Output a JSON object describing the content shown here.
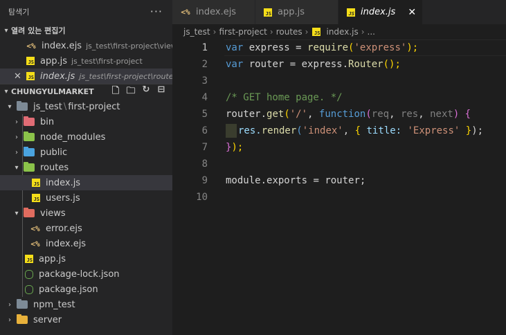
{
  "sidebar": {
    "title": "탐색기",
    "more": "···",
    "open_editors": {
      "header": "열려 있는 편집기",
      "items": [
        {
          "name": "index.ejs",
          "desc": "js_test\\first-project\\views"
        },
        {
          "name": "app.js",
          "desc": "js_test\\first-project"
        },
        {
          "name": "index.js",
          "desc": "js_test\\first-project\\routes"
        }
      ]
    },
    "workspace": {
      "header": "CHUNGYULMARKET",
      "tree": [
        {
          "label": "js_test",
          "label2": "first-project"
        },
        {
          "label": "bin"
        },
        {
          "label": "node_modules"
        },
        {
          "label": "public"
        },
        {
          "label": "routes"
        },
        {
          "label": "index.js"
        },
        {
          "label": "users.js"
        },
        {
          "label": "views"
        },
        {
          "label": "error.ejs"
        },
        {
          "label": "index.ejs"
        },
        {
          "label": "app.js"
        },
        {
          "label": "package-lock.json"
        },
        {
          "label": "package.json"
        },
        {
          "label": "npm_test"
        },
        {
          "label": "server"
        }
      ]
    }
  },
  "tabs": [
    {
      "label": "index.ejs",
      "icon": "ejs-file-icon"
    },
    {
      "label": "app.js",
      "icon": "js-file-icon"
    },
    {
      "label": "index.js",
      "icon": "js-file-icon",
      "active": true
    }
  ],
  "breadcrumb": [
    "js_test",
    "first-project",
    "routes",
    "index.js",
    "..."
  ],
  "code": {
    "line_numbers": [
      "1",
      "2",
      "3",
      "4",
      "5",
      "6",
      "7",
      "8",
      "9",
      "10"
    ],
    "l1": [
      "var",
      " express = ",
      "require",
      "(",
      "'express'",
      ");"
    ],
    "l2": [
      "var",
      " router = express.",
      "Router",
      "();"
    ],
    "l4": "/* GET home page. */",
    "l5": [
      "router.",
      "get",
      "(",
      "'/'",
      ", ",
      "function",
      "(",
      "req",
      ", ",
      "res",
      ", ",
      "next",
      ") ",
      "{"
    ],
    "l6": [
      "res.",
      "render",
      "(",
      "'index'",
      ", ",
      "{",
      " title: ",
      "'Express'",
      " ",
      "}",
      ");"
    ],
    "l7": [
      "}",
      ");"
    ],
    "l9": [
      "module",
      ".",
      "exports",
      " = router;"
    ]
  },
  "colors": {
    "keyword": "#569cd6",
    "string": "#ce9178",
    "comment": "#6a9955",
    "function": "#dcdcaa",
    "bracket_gold": "#ffd700",
    "bracket_purple": "#da70d6"
  }
}
